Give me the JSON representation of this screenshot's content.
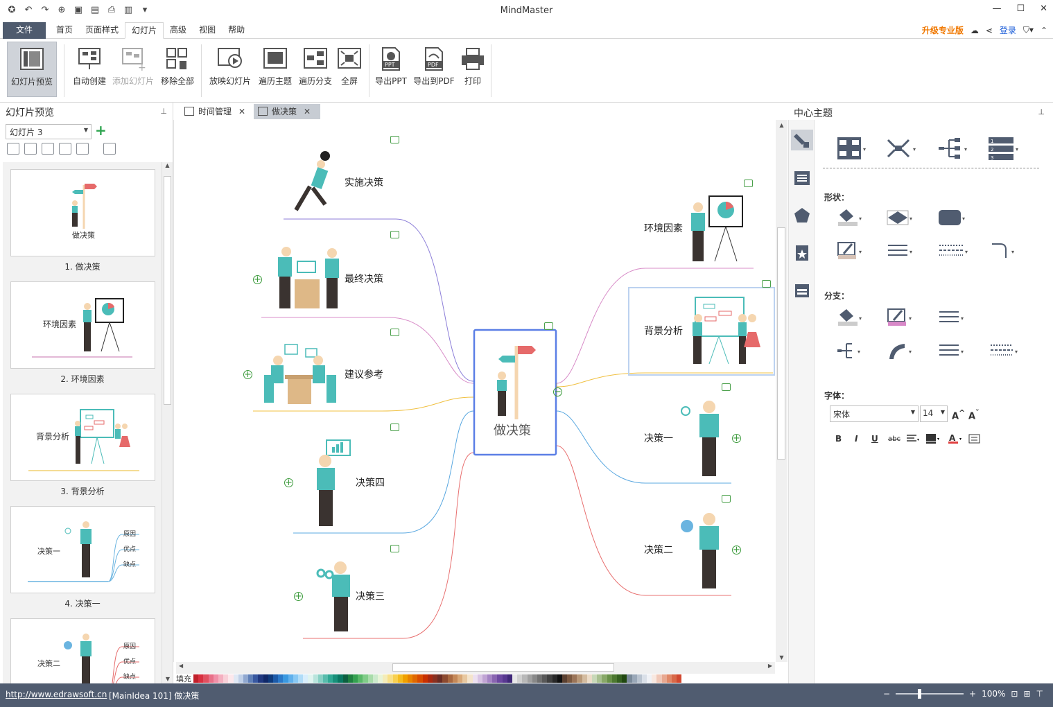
{
  "window": {
    "title": "MindMaster"
  },
  "menu": {
    "file": "文件",
    "tabs": [
      "首页",
      "页面样式",
      "幻灯片",
      "高级",
      "视图",
      "帮助"
    ],
    "active_tab": "幻灯片",
    "upgrade": "升级专业版",
    "login": "登录"
  },
  "ribbon": {
    "buttons": [
      {
        "label": "幻灯片预览",
        "icon": "slide-preview-icon"
      },
      {
        "label": "自动创建",
        "icon": "auto-create-icon"
      },
      {
        "label": "添加幻灯片",
        "icon": "add-slide-icon"
      },
      {
        "label": "移除全部",
        "icon": "remove-all-icon"
      },
      {
        "label": "放映幻灯片",
        "icon": "play-slides-icon"
      },
      {
        "label": "遍历主题",
        "icon": "traverse-topic-icon"
      },
      {
        "label": "遍历分支",
        "icon": "traverse-branch-icon"
      },
      {
        "label": "全屏",
        "icon": "fullscreen-icon"
      },
      {
        "label": "导出PPT",
        "icon": "export-ppt-icon"
      },
      {
        "label": "导出到PDF",
        "icon": "export-pdf-icon"
      },
      {
        "label": "打印",
        "icon": "print-icon"
      }
    ],
    "ppt_badge": "PPT",
    "pdf_badge": "PDF"
  },
  "left_panel": {
    "title": "幻灯片预览",
    "selected_slide": "幻灯片 3",
    "slides": [
      {
        "caption": "1. 做决策",
        "text": "做决策"
      },
      {
        "caption": "2. 环境因素",
        "text": "环境因素"
      },
      {
        "caption": "3. 背景分析",
        "text": "背景分析"
      },
      {
        "caption": "4. 决策一",
        "text": "决策一",
        "sub": [
          "原因",
          "优点",
          "缺点"
        ]
      },
      {
        "caption": "",
        "text": "决策二",
        "sub": [
          "原因",
          "优点",
          "缺点"
        ]
      }
    ]
  },
  "doc_tabs": [
    {
      "label": "时间管理",
      "active": false
    },
    {
      "label": "做决策",
      "active": true
    }
  ],
  "mindmap": {
    "center": "做决策",
    "left": [
      "实施决策",
      "最终决策",
      "建议参考",
      "决策四",
      "决策三"
    ],
    "right": [
      "环境因素",
      "背景分析",
      "决策一",
      "决策二"
    ]
  },
  "right_panel": {
    "title": "中心主题",
    "shape_label": "形状：",
    "branch_label": "分支：",
    "font_label": "字体：",
    "font_family": "宋体",
    "font_size": "14",
    "format_buttons": [
      "B",
      "I",
      "U",
      "abc"
    ],
    "list_numbers": [
      "1",
      "2",
      "3"
    ]
  },
  "fill_label": "填充",
  "status": {
    "url": "http://www.edrawsoft.cn",
    "info": "[MainIdea 101]  做决策",
    "zoom": "100%"
  },
  "colors": {
    "accent_teal": "#4bbcb8",
    "status_bar": "#505c70",
    "upgrade": "#f07800",
    "login": "#1e5fd8",
    "selection": "#5b7fe6"
  }
}
